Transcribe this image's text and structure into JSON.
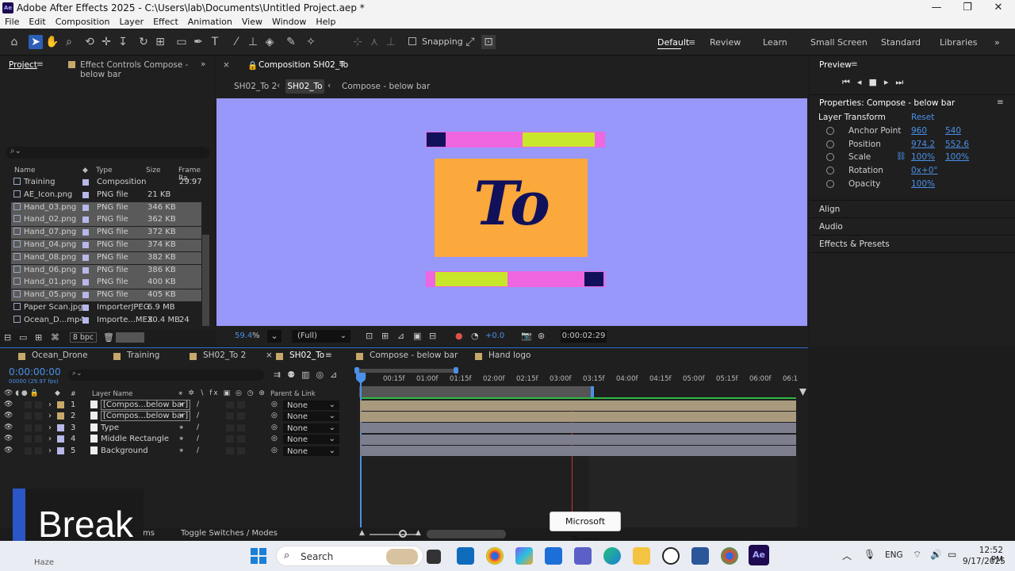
{
  "window": {
    "title": "Adobe After Effects 2025 - C:\\Users\\lab\\Documents\\Untitled Project.aep *",
    "logo": "Ae"
  },
  "menu": [
    "File",
    "Edit",
    "Composition",
    "Layer",
    "Effect",
    "Animation",
    "View",
    "Window",
    "Help"
  ],
  "toolbar": {
    "snapping": "Snapping"
  },
  "workspaces": [
    "Default",
    "Review",
    "Learn",
    "Small Screen",
    "Standard",
    "Libraries"
  ],
  "project": {
    "tab1": "Project",
    "tab2": "Effect Controls Compose - below bar",
    "search_placeholder": "",
    "columns": [
      "Name",
      "Type",
      "Size",
      "Frame Ra..."
    ],
    "items": [
      {
        "name": "Training",
        "type": "Composition",
        "size": "",
        "fr": "29.97",
        "sel": false
      },
      {
        "name": "AE_Icon.png",
        "type": "PNG file",
        "size": "21 KB",
        "fr": "",
        "sel": false
      },
      {
        "name": "Hand_03.png",
        "type": "PNG file",
        "size": "346 KB",
        "fr": "",
        "sel": true
      },
      {
        "name": "Hand_02.png",
        "type": "PNG file",
        "size": "362 KB",
        "fr": "",
        "sel": true
      },
      {
        "name": "Hand_07.png",
        "type": "PNG file",
        "size": "372 KB",
        "fr": "",
        "sel": true
      },
      {
        "name": "Hand_04.png",
        "type": "PNG file",
        "size": "374 KB",
        "fr": "",
        "sel": true
      },
      {
        "name": "Hand_08.png",
        "type": "PNG file",
        "size": "382 KB",
        "fr": "",
        "sel": true
      },
      {
        "name": "Hand_06.png",
        "type": "PNG file",
        "size": "386 KB",
        "fr": "",
        "sel": true
      },
      {
        "name": "Hand_01.png",
        "type": "PNG file",
        "size": "400 KB",
        "fr": "",
        "sel": true
      },
      {
        "name": "Hand_05.png",
        "type": "PNG file",
        "size": "405 KB",
        "fr": "",
        "sel": true
      },
      {
        "name": "Paper Scan.jpg",
        "type": "ImporterJPEG",
        "size": "6.9 MB",
        "fr": "",
        "sel": false
      },
      {
        "name": "Ocean_D...mp4",
        "type": "Importe...MEX",
        "size": "30.4 MB",
        "fr": "24",
        "sel": false
      }
    ],
    "bpc": "8 bpc"
  },
  "composition": {
    "tab": "Composition SH02_To",
    "crumbs": [
      "SH02_To 2",
      "SH02_To",
      "Compose - below bar"
    ],
    "text": "To",
    "zoom": "59.4",
    "zoom_unit": "%",
    "resolution": "(Full)",
    "exposure": "+0.0",
    "timecode": "0:00:02:29"
  },
  "preview": {
    "title": "Preview"
  },
  "properties": {
    "title": "Properties: Compose - below bar",
    "section": "Layer Transform",
    "reset": "Reset",
    "rows": [
      {
        "label": "Anchor Point",
        "v1": "960",
        "v2": "540"
      },
      {
        "label": "Position",
        "v1": "974.2",
        "v2": "552.6"
      },
      {
        "label": "Scale",
        "v1": "100%",
        "v2": "100%"
      },
      {
        "label": "Rotation",
        "v1": "0x+0°",
        "v2": ""
      },
      {
        "label": "Opacity",
        "v1": "100%",
        "v2": ""
      }
    ],
    "panels": [
      "Align",
      "Audio",
      "Effects & Presets"
    ]
  },
  "timeline": {
    "tabs": [
      "Ocean_Drone",
      "Training",
      "SH02_To 2",
      "SH02_To",
      "Compose - below bar",
      "Hand logo"
    ],
    "time": "0:00:00:00",
    "time_sub": "00000 (29.97 fps)",
    "col_layer": "Layer Name",
    "col_parent": "Parent & Link",
    "ruler": [
      "0f",
      "00:15f",
      "01:00f",
      "01:15f",
      "02:00f",
      "02:15f",
      "03:00f",
      "03:15f",
      "04:00f",
      "04:15f",
      "05:00f",
      "05:15f",
      "06:00f",
      "06:1"
    ],
    "layers": [
      {
        "n": "1",
        "name": "[Compos...below bar]",
        "parent": "None"
      },
      {
        "n": "2",
        "name": "[Compos...below bar]",
        "parent": "None"
      },
      {
        "n": "3",
        "name": "Type",
        "parent": "None"
      },
      {
        "n": "4",
        "name": "Middle Rectangle",
        "parent": "None"
      },
      {
        "n": "5",
        "name": "Background",
        "parent": "None"
      }
    ],
    "footer": "Toggle Switches / Modes",
    "footer_left": "ms"
  },
  "overlay": {
    "break": "Break",
    "tooltip": "Microsoft Teams"
  },
  "taskbar": {
    "search": "Search",
    "lang": "ENG",
    "time": "12:52 PM",
    "date": "9/17/2025",
    "weather": "Haze"
  }
}
